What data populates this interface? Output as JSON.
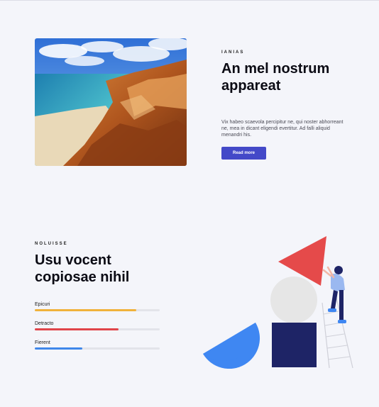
{
  "feature": {
    "eyebrow": "IANIAS",
    "title": "An mel nostrum appareat",
    "body": "Vix habeo scaevola percipitur ne, qui noster abhorreant ne, mea in dicant eligendi evertitur. Ad falli aliquid menandri his.",
    "button_label": "Read more",
    "image_icon": "coastal-cliffs-photo"
  },
  "skills_section": {
    "eyebrow": "NOLUISSE",
    "title": "Usu vocent copiosae nihil",
    "skills": [
      {
        "label": "Epicuri",
        "value": 0.81,
        "color": "#f0b23b"
      },
      {
        "label": "Detracto",
        "value": 0.67,
        "color": "#e0454a"
      },
      {
        "label": "Fierent",
        "value": 0.38,
        "color": "#3f87ea"
      }
    ],
    "illustration_icon": "shapes-person-ladder-illustration"
  },
  "colors": {
    "background": "#f4f5fa",
    "accent": "#4349c8",
    "navy": "#1e2466",
    "red": "#e54a4a",
    "blue": "#3f87f2"
  }
}
